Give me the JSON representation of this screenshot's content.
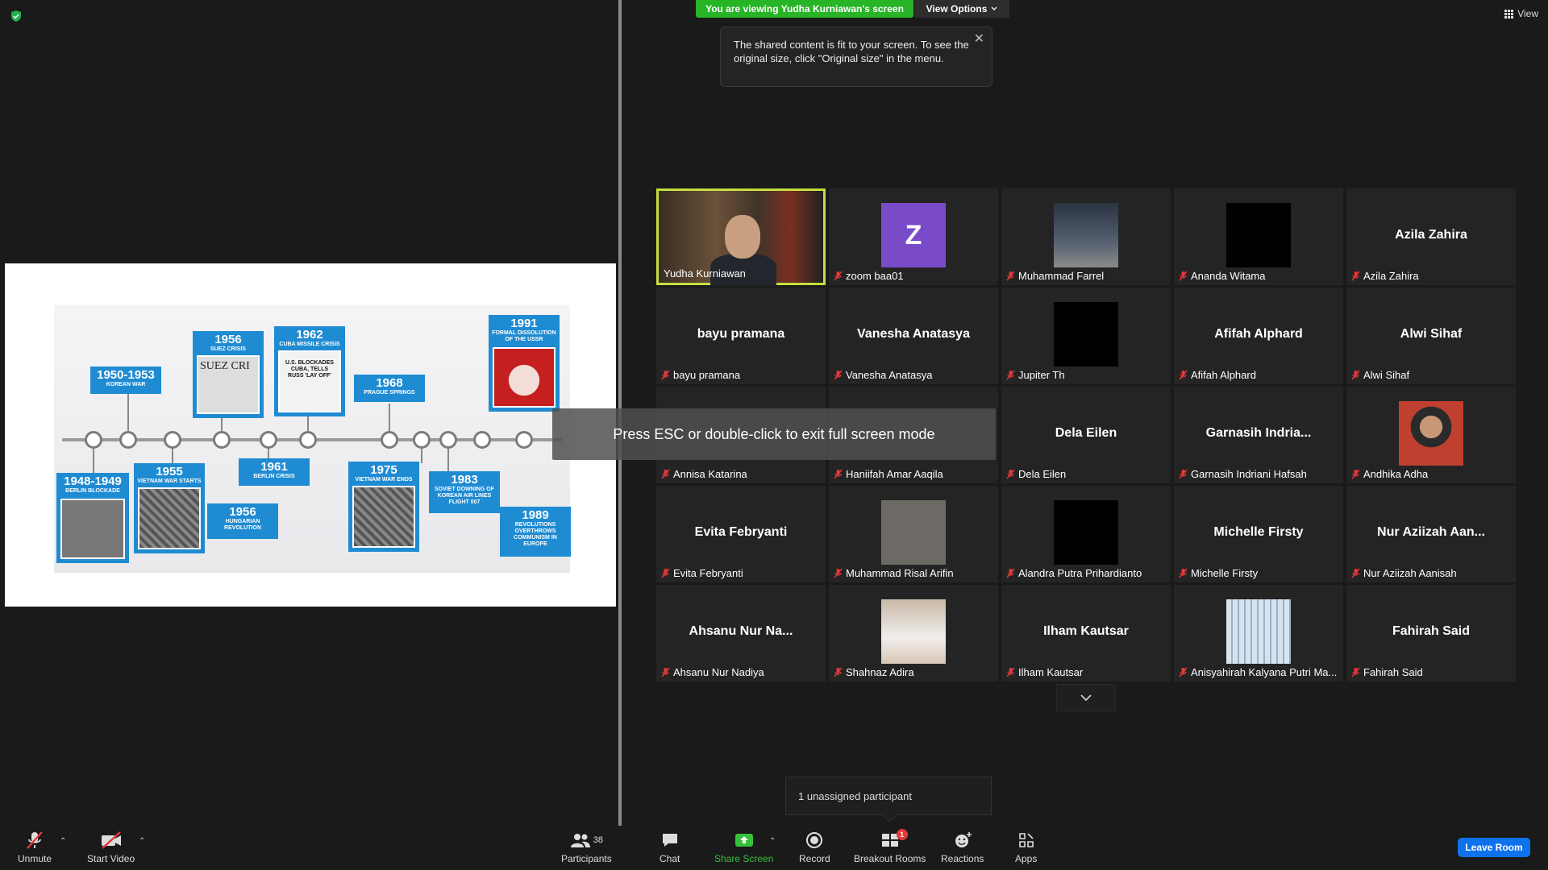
{
  "banner": {
    "viewing_text": "You are viewing Yudha Kurniawan's screen",
    "view_options_label": "View Options",
    "view_button_label": "View"
  },
  "tooltip": {
    "text": "The shared content is fit to your screen. To see the original size, click \"Original size\" in the menu."
  },
  "overlay": {
    "esc_message": "Press ESC or double-click to exit full screen mode"
  },
  "slide": {
    "events": [
      {
        "year": "1948-1949",
        "caption": "BERLIN BLOCKADE"
      },
      {
        "year": "1950-1953",
        "caption": "KOREAN WAR"
      },
      {
        "year": "1955",
        "caption": "VIETNAM WAR STARTS"
      },
      {
        "year": "1956",
        "caption": "SUEZ CRISIS"
      },
      {
        "year": "1956",
        "caption": "HUNGARIAN REVOLUTION"
      },
      {
        "year": "1961",
        "caption": "BERLIN CRISIS"
      },
      {
        "year": "1962",
        "caption": "CUBA MISSILE CRISIS"
      },
      {
        "year": "1968",
        "caption": "PRAGUE SPRINGS"
      },
      {
        "year": "1975",
        "caption": "VIETNAM WAR ENDS"
      },
      {
        "year": "1983",
        "caption": "SOVIET DOWNING OF KOREAN AIR LINES FLIGHT 007"
      },
      {
        "year": "1989",
        "caption": "REVOLUTIONS OVERTHROWS COMMUNISM IN EUROPE"
      },
      {
        "year": "1991",
        "caption": "FORMAL DISSOLUTION OF THE USSR"
      }
    ],
    "suez_photo_text": "SUEZ CRI",
    "cuba_headline": "U.S. BLOCKADES CUBA, TELLS RUSS 'LAY OFF'"
  },
  "gallery": {
    "tiles": [
      {
        "big": "",
        "name": "Yudha Kurniawan"
      },
      {
        "big": "",
        "name": "zoom baa01",
        "initial": "Z"
      },
      {
        "big": "",
        "name": "Muhammad Farrel"
      },
      {
        "big": "",
        "name": "Ananda Witama"
      },
      {
        "big": "Azila Zahira",
        "name": "Azila Zahira"
      },
      {
        "big": "bayu pramana",
        "name": "bayu pramana"
      },
      {
        "big": "Vanesha Anatasya",
        "name": "Vanesha Anatasya"
      },
      {
        "big": "",
        "name": "Jupiter Th"
      },
      {
        "big": "Afifah Alphard",
        "name": "Afifah Alphard"
      },
      {
        "big": "Alwi Sihaf",
        "name": "Alwi Sihaf"
      },
      {
        "big": "",
        "name": "Annisa Katarina"
      },
      {
        "big": "",
        "name": "Haniifah Amar Aaqila"
      },
      {
        "big": "Dela Eilen",
        "name": "Dela Eilen"
      },
      {
        "big": "Garnasih Indria...",
        "name": "Garnasih Indriani Hafsah"
      },
      {
        "big": "",
        "name": "Andhika Adha"
      },
      {
        "big": "Evita Febryanti",
        "name": "Evita Febryanti"
      },
      {
        "big": "",
        "name": "Muhammad Risal Arifin"
      },
      {
        "big": "",
        "name": "Alandra Putra Prihardianto"
      },
      {
        "big": "Michelle Firsty",
        "name": "Michelle Firsty"
      },
      {
        "big": "Nur Aziizah Aan...",
        "name": "Nur Aziizah Aanisah"
      },
      {
        "big": "Ahsanu Nur Na...",
        "name": "Ahsanu Nur Nadiya"
      },
      {
        "big": "",
        "name": "Shahnaz Adira"
      },
      {
        "big": "Ilham Kautsar",
        "name": "Ilham Kautsar"
      },
      {
        "big": "",
        "name": "Anisyahirah Kalyana Putri Ma..."
      },
      {
        "big": "Fahirah Said",
        "name": "Fahirah Said"
      }
    ]
  },
  "unassigned": {
    "text": "1 unassigned participant"
  },
  "toolbar": {
    "unmute": "Unmute",
    "start_video": "Start Video",
    "participants": "Participants",
    "participant_count": "38",
    "chat": "Chat",
    "share_screen": "Share Screen",
    "record": "Record",
    "breakout_rooms": "Breakout Rooms",
    "breakout_badge": "1",
    "reactions": "Reactions",
    "apps": "Apps",
    "leave_room": "Leave Room"
  },
  "colors": {
    "banner_green": "#27b427",
    "active_speaker": "#c5df3f",
    "timeline_blue": "#1f8bd2",
    "leave_blue": "#0e72ed",
    "badge_red": "#e5393a"
  }
}
